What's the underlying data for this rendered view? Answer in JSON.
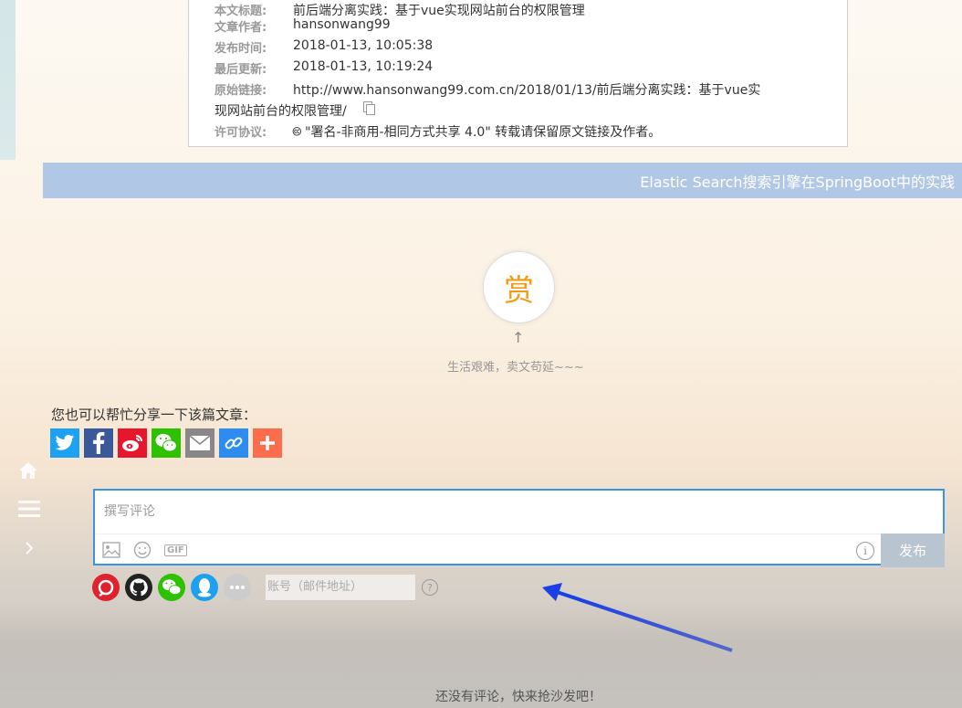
{
  "license": {
    "rows": [
      {
        "key": "本文标题:",
        "value": "前后端分离实践：基于vue实现网站前台的权限管理"
      },
      {
        "key": "文章作者:",
        "value": "hansonwang99"
      },
      {
        "key": "发布时间:",
        "value": "2018-01-13, 10:05:38"
      },
      {
        "key": "最后更新:",
        "value": "2018-01-13, 10:19:24"
      },
      {
        "key": "原始链接:",
        "value": "http://www.hansonwang99.com.cn/2018/01/13/前后端分离实践：基于vue实",
        "value2": "现网站前台的权限管理/"
      },
      {
        "key": "许可协议:",
        "value": "🅭 \"署名-非商用-相同方式共享 4.0\" 转载请保留原文链接及作者。"
      }
    ]
  },
  "next_post": {
    "label": "Elastic Search搜索引擎在SpringBoot中的实践"
  },
  "reward": {
    "button": "赏",
    "arrow": "↑",
    "caption": "生活艰难，卖文苟延~~~"
  },
  "share": {
    "title": "您也可以帮忙分享一下该篇文章：",
    "buttons": [
      {
        "name": "twitter",
        "color": "#1da1f2",
        "icon": "twitter-icon"
      },
      {
        "name": "facebook",
        "color": "#3b5998",
        "icon": "facebook-icon"
      },
      {
        "name": "weibo",
        "color": "#e6162d",
        "icon": "weibo-icon"
      },
      {
        "name": "wechat",
        "color": "#2dc100",
        "icon": "wechat-icon"
      },
      {
        "name": "email",
        "color": "#888888",
        "icon": "email-icon"
      },
      {
        "name": "link",
        "color": "#2d8cf0",
        "icon": "link-icon"
      },
      {
        "name": "more",
        "color": "#fc6d4c",
        "icon": "plus-icon"
      }
    ]
  },
  "comment": {
    "placeholder": "撰写评论",
    "gif": "GIF",
    "info": "i",
    "publish": "发布",
    "account_placeholder": "账号（邮件地址）",
    "help": "?",
    "login_icons": [
      {
        "name": "douban",
        "color": "#e0222f"
      },
      {
        "name": "github",
        "color": "#222222"
      },
      {
        "name": "wechat",
        "color": "#2dc100"
      },
      {
        "name": "qq",
        "color": "#1ea0f0"
      },
      {
        "name": "more",
        "color": "#cccccc"
      }
    ],
    "empty_message": "还没有评论，快来抢沙发吧！"
  },
  "annotation": {
    "arrow_color": "#1a3fe6"
  }
}
